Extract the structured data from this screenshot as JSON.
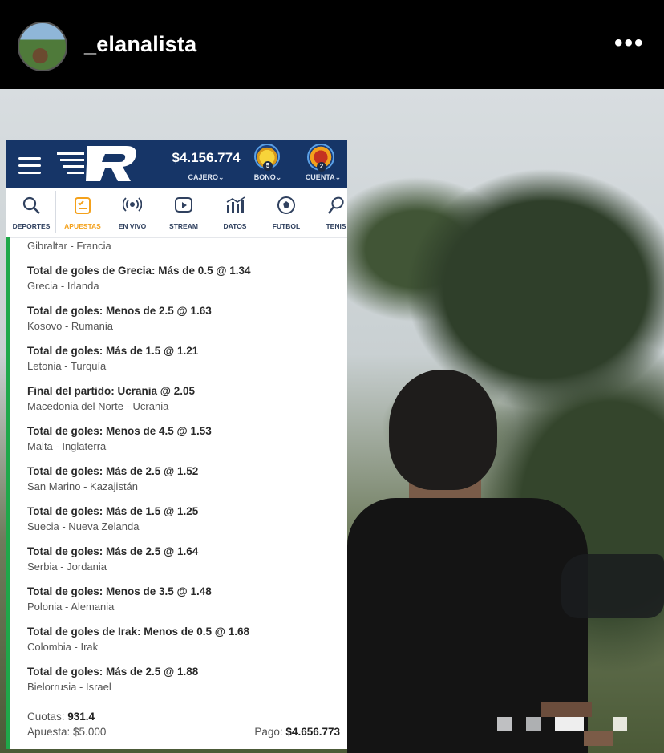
{
  "instagram": {
    "username": "_elanalista",
    "more_icon": "more-horizontal-icon"
  },
  "app": {
    "balance": "$4.156.774",
    "cajero_label": "CAJERO⌄",
    "bono_label": "BONO⌄",
    "bono_badge": "5",
    "cuenta_label": "CUENTA⌄",
    "cuenta_badge": "2",
    "nav": [
      {
        "label": "DEPORTES",
        "icon": "search-icon"
      },
      {
        "label": "APUESTAS",
        "icon": "betslip-icon"
      },
      {
        "label": "EN VIVO",
        "icon": "live-broadcast-icon"
      },
      {
        "label": "STREAM",
        "icon": "play-stream-icon"
      },
      {
        "label": "DATOS",
        "icon": "stats-chart-icon"
      },
      {
        "label": "FUTBOL",
        "icon": "soccer-ball-icon"
      },
      {
        "label": "TENIS",
        "icon": "tennis-icon"
      }
    ],
    "active_nav": "APUESTAS",
    "prev_match": "Gibraltar - Francia",
    "bets": [
      {
        "title": "Total de goles de Grecia: Más de 0.5 @ 1.34",
        "match": "Grecia - Irlanda"
      },
      {
        "title": "Total de goles: Menos de 2.5 @ 1.63",
        "match": "Kosovo - Rumania"
      },
      {
        "title": "Total de goles: Más de 1.5 @ 1.21",
        "match": "Letonia - Turquía"
      },
      {
        "title": "Final del partido: Ucrania @ 2.05",
        "match": "Macedonia del Norte - Ucrania"
      },
      {
        "title": "Total de goles: Menos de 4.5 @ 1.53",
        "match": "Malta - Inglaterra"
      },
      {
        "title": "Total de goles: Más de 2.5 @ 1.52",
        "match": "San Marino - Kazajistán"
      },
      {
        "title": "Total de goles: Más de 1.5 @ 1.25",
        "match": "Suecia - Nueva Zelanda"
      },
      {
        "title": "Total de goles: Más de 2.5 @ 1.64",
        "match": "Serbia - Jordania"
      },
      {
        "title": "Total de goles: Menos de 3.5 @ 1.48",
        "match": "Polonia - Alemania"
      },
      {
        "title": "Total de goles de Irak: Menos de 0.5 @ 1.68",
        "match": "Colombia - Irak"
      },
      {
        "title": "Total de goles: Más de 2.5 @ 1.88",
        "match": "Bielorrusia - Israel"
      }
    ],
    "summary": {
      "cuotas_label": "Cuotas:",
      "cuotas_value": "931.4",
      "apuesta_label": "Apuesta:",
      "apuesta_value": "$5.000",
      "pago_label": "Pago:",
      "pago_value": "$4.656.773"
    },
    "colors": {
      "topbar": "#163567",
      "accent": "#f4a11b",
      "stripe": "#1fa84a"
    }
  }
}
